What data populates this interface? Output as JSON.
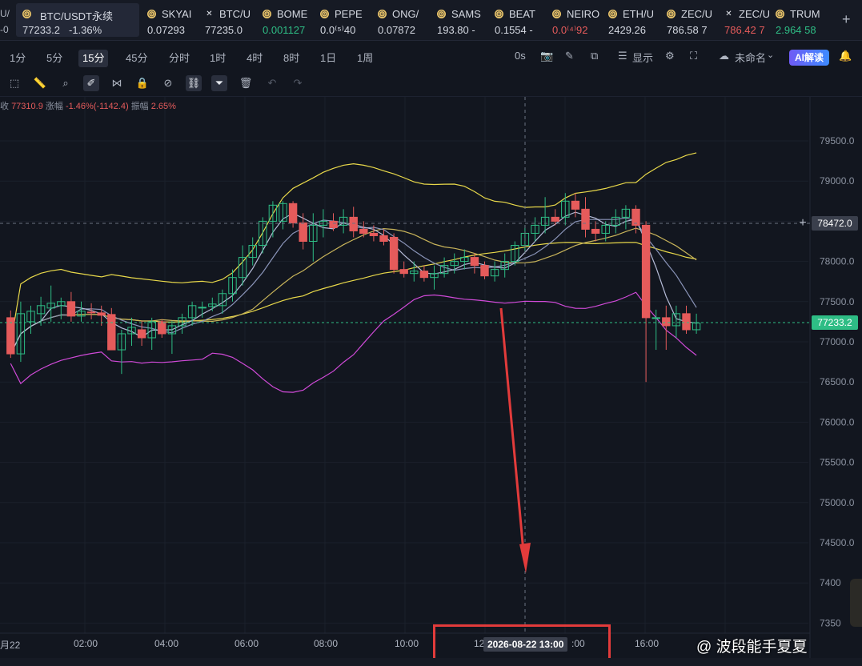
{
  "tickers": [
    {
      "name": "BTC/USDT永续",
      "price": "77233.2",
      "change": "-1.36%",
      "icon": "coin-icon",
      "active": true
    },
    {
      "name": "SKYAI",
      "price": "0.07293",
      "icon": "coin-icon"
    },
    {
      "name": "BTC/U",
      "price": "77235.0",
      "icon": "close-x-icon"
    },
    {
      "name": "BOME",
      "price": "0.001127",
      "icon": "coin-icon"
    },
    {
      "name": "PEPE",
      "price": "0.0⁽⁵⁾40",
      "icon": "coin-icon"
    },
    {
      "name": "ONG/",
      "price": "0.07872",
      "icon": "coin-icon"
    },
    {
      "name": "SAMS",
      "price": "193.80 -",
      "icon": "coin-icon"
    },
    {
      "name": "BEAT",
      "price": "0.1554 -",
      "icon": "coin-icon"
    },
    {
      "name": "NEIRO",
      "price": "0.0⁽⁴⁾92",
      "icon": "coin-icon"
    },
    {
      "name": "ETH/U",
      "price": "2429.26",
      "icon": "coin-icon"
    },
    {
      "name": "ZEC/U",
      "price": "786.58 7",
      "icon": "coin-icon"
    },
    {
      "name": "ZEC/U",
      "price": "786.42 7",
      "icon": "close-x-icon"
    },
    {
      "name": "TRUM",
      "price": "2.964 58",
      "icon": "coin-icon"
    }
  ],
  "left_edge_top": "U/",
  "left_edge_bottom": "-0",
  "intervals": [
    "1分",
    "5分",
    "15分",
    "45分",
    "分时",
    "1时",
    "4时",
    "8时",
    "1日",
    "1周"
  ],
  "selected_interval": "15分",
  "toolbar_right": {
    "timer": "0s",
    "display": "显示",
    "layout_name": "未命名",
    "ai_button": "AI解读"
  },
  "legend": {
    "close_prefix": "收",
    "close": "77310.9",
    "change_label": "涨幅",
    "change": "-1.46%(-1142.4)",
    "amplitude_label": "振幅",
    "amplitude": "2.65%"
  },
  "price_axis_ticks": [
    "79500.0",
    "79000.0",
    "78500.0",
    "78000.0",
    "77500.0",
    "77000.0",
    "76500.0",
    "76000.0",
    "75500.0",
    "75000.0",
    "74500.0",
    "7400",
    "7350"
  ],
  "price_labels": {
    "crosshair": "78472.0",
    "last": "77233.2"
  },
  "time_axis_ticks": [
    "月22",
    "02:00",
    "04:00",
    "06:00",
    "08:00",
    "10:00",
    "12",
    ":00",
    "16:00"
  ],
  "crosshair_time": "2026-08-22 13:00",
  "watermark": "@ 波段能手夏夏",
  "colors": {
    "up": "#2ebd85",
    "down": "#e55b5b",
    "bg": "#12161f",
    "annotation": "#e23b3b"
  },
  "chart_data": {
    "type": "candlestick",
    "interval": "15分",
    "ylim": [
      73400,
      79800
    ],
    "x_start": "2026-08-21 23:30",
    "candles": [
      {
        "o": 77300,
        "h": 77390,
        "l": 76800,
        "c": 76850
      },
      {
        "o": 76850,
        "h": 77500,
        "l": 76750,
        "c": 77350
      },
      {
        "o": 77250,
        "h": 77450,
        "l": 77100,
        "c": 77380
      },
      {
        "o": 77350,
        "h": 77560,
        "l": 77200,
        "c": 77450
      },
      {
        "o": 77420,
        "h": 77700,
        "l": 77250,
        "c": 77480
      },
      {
        "o": 77450,
        "h": 77550,
        "l": 77280,
        "c": 77500
      },
      {
        "o": 77500,
        "h": 77620,
        "l": 77250,
        "c": 77320
      },
      {
        "o": 77320,
        "h": 77500,
        "l": 77250,
        "c": 77380
      },
      {
        "o": 77370,
        "h": 77480,
        "l": 77280,
        "c": 77360
      },
      {
        "o": 77360,
        "h": 77450,
        "l": 77200,
        "c": 77330
      },
      {
        "o": 77340,
        "h": 77420,
        "l": 77000,
        "c": 76900
      },
      {
        "o": 76900,
        "h": 77150,
        "l": 76600,
        "c": 77100
      },
      {
        "o": 77100,
        "h": 77300,
        "l": 76950,
        "c": 77180
      },
      {
        "o": 77150,
        "h": 77260,
        "l": 76950,
        "c": 77050
      },
      {
        "o": 77050,
        "h": 77300,
        "l": 76900,
        "c": 77250
      },
      {
        "o": 77250,
        "h": 77280,
        "l": 77050,
        "c": 77100
      },
      {
        "o": 77100,
        "h": 77260,
        "l": 76850,
        "c": 77200
      },
      {
        "o": 77200,
        "h": 77350,
        "l": 77100,
        "c": 77300
      },
      {
        "o": 77300,
        "h": 77500,
        "l": 77200,
        "c": 77450
      },
      {
        "o": 77420,
        "h": 77500,
        "l": 77300,
        "c": 77430
      },
      {
        "o": 77440,
        "h": 77550,
        "l": 77380,
        "c": 77470
      },
      {
        "o": 77450,
        "h": 77650,
        "l": 77350,
        "c": 77600
      },
      {
        "o": 77600,
        "h": 77900,
        "l": 77500,
        "c": 77800
      },
      {
        "o": 77800,
        "h": 78200,
        "l": 77700,
        "c": 78050
      },
      {
        "o": 78050,
        "h": 78300,
        "l": 77950,
        "c": 78200
      },
      {
        "o": 78200,
        "h": 78550,
        "l": 78100,
        "c": 78500
      },
      {
        "o": 78500,
        "h": 78750,
        "l": 78300,
        "c": 78700
      },
      {
        "o": 78500,
        "h": 78750,
        "l": 78400,
        "c": 78720
      },
      {
        "o": 78720,
        "h": 78750,
        "l": 78420,
        "c": 78480
      },
      {
        "o": 78480,
        "h": 78600,
        "l": 78150,
        "c": 78250
      },
      {
        "o": 78250,
        "h": 78600,
        "l": 78000,
        "c": 78450
      },
      {
        "o": 78450,
        "h": 78650,
        "l": 78300,
        "c": 78500
      },
      {
        "o": 78500,
        "h": 78600,
        "l": 78380,
        "c": 78420
      },
      {
        "o": 78450,
        "h": 78650,
        "l": 78350,
        "c": 78550
      },
      {
        "o": 78550,
        "h": 78680,
        "l": 78300,
        "c": 78380
      },
      {
        "o": 78400,
        "h": 78500,
        "l": 78300,
        "c": 78350
      },
      {
        "o": 78350,
        "h": 78450,
        "l": 78250,
        "c": 78320
      },
      {
        "o": 78320,
        "h": 78400,
        "l": 78200,
        "c": 78250
      },
      {
        "o": 78300,
        "h": 78350,
        "l": 77850,
        "c": 77900
      },
      {
        "o": 77900,
        "h": 78000,
        "l": 77800,
        "c": 77850
      },
      {
        "o": 77850,
        "h": 78000,
        "l": 77750,
        "c": 77880
      },
      {
        "o": 77880,
        "h": 77950,
        "l": 77750,
        "c": 77800
      },
      {
        "o": 77800,
        "h": 77950,
        "l": 77650,
        "c": 77850
      },
      {
        "o": 77850,
        "h": 78050,
        "l": 77800,
        "c": 77950
      },
      {
        "o": 77950,
        "h": 78100,
        "l": 77850,
        "c": 78000
      },
      {
        "o": 78000,
        "h": 78150,
        "l": 77900,
        "c": 78050
      },
      {
        "o": 78050,
        "h": 78100,
        "l": 77850,
        "c": 77950
      },
      {
        "o": 77950,
        "h": 78000,
        "l": 77780,
        "c": 77820
      },
      {
        "o": 77820,
        "h": 78000,
        "l": 77750,
        "c": 77900
      },
      {
        "o": 77900,
        "h": 78100,
        "l": 77800,
        "c": 78000
      },
      {
        "o": 78000,
        "h": 78250,
        "l": 77950,
        "c": 78200
      },
      {
        "o": 78200,
        "h": 78450,
        "l": 78100,
        "c": 78350
      },
      {
        "o": 78350,
        "h": 78550,
        "l": 78250,
        "c": 78450
      },
      {
        "o": 78450,
        "h": 78800,
        "l": 78350,
        "c": 78550
      },
      {
        "o": 78550,
        "h": 78650,
        "l": 78450,
        "c": 78500
      },
      {
        "o": 78550,
        "h": 78850,
        "l": 78450,
        "c": 78750
      },
      {
        "o": 78750,
        "h": 78850,
        "l": 78550,
        "c": 78650
      },
      {
        "o": 78650,
        "h": 78800,
        "l": 78300,
        "c": 78400
      },
      {
        "o": 78400,
        "h": 78500,
        "l": 78250,
        "c": 78350
      },
      {
        "o": 78350,
        "h": 78500,
        "l": 78250,
        "c": 78450
      },
      {
        "o": 78450,
        "h": 78650,
        "l": 78350,
        "c": 78550
      },
      {
        "o": 78550,
        "h": 78700,
        "l": 78400,
        "c": 78650
      },
      {
        "o": 78650,
        "h": 78700,
        "l": 78350,
        "c": 78450
      },
      {
        "o": 78450,
        "h": 78500,
        "l": 76500,
        "c": 77300
      },
      {
        "o": 77300,
        "h": 77400,
        "l": 76900,
        "c": 77300
      },
      {
        "o": 77300,
        "h": 77450,
        "l": 76900,
        "c": 77200
      },
      {
        "o": 77200,
        "h": 77450,
        "l": 77050,
        "c": 77350
      },
      {
        "o": 77350,
        "h": 77450,
        "l": 77100,
        "c": 77150
      },
      {
        "o": 77150,
        "h": 77350,
        "l": 77100,
        "c": 77233.2
      }
    ]
  }
}
